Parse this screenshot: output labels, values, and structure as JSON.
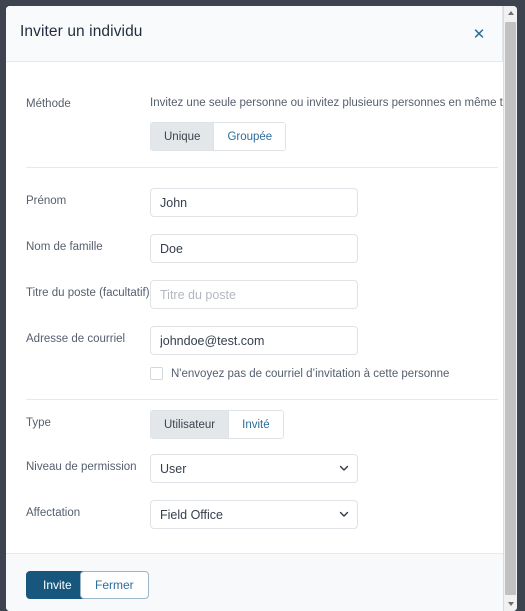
{
  "dialog": {
    "title": "Inviter un individu",
    "close_icon": "close-icon",
    "close_glyph": "✕"
  },
  "method": {
    "label": "Méthode",
    "helper": "Invitez une seule personne ou invitez plusieurs personnes en même temps.",
    "options": [
      {
        "label": "Unique",
        "selected": true
      },
      {
        "label": "Groupée",
        "selected": false
      }
    ]
  },
  "fields": {
    "first_name": {
      "label": "Prénom",
      "value": "John",
      "placeholder": ""
    },
    "last_name": {
      "label": "Nom de famille",
      "value": "Doe",
      "placeholder": ""
    },
    "job_title": {
      "label": "Titre du poste (facultatif)",
      "value": "",
      "placeholder": "Titre du poste"
    },
    "email": {
      "label": "Adresse de courriel",
      "value": "johndoe@test.com",
      "placeholder": ""
    }
  },
  "no_email_checkbox": {
    "label": "N'envoyez pas de courriel d’invitation à cette personne",
    "checked": false
  },
  "type": {
    "label": "Type",
    "options": [
      {
        "label": "Utilisateur",
        "selected": true
      },
      {
        "label": "Invité",
        "selected": false
      }
    ]
  },
  "permission": {
    "label": "Niveau de permission",
    "value": "User",
    "chevron_icon": "chevron-down-icon"
  },
  "assignment": {
    "label": "Affectation",
    "value": "Field Office",
    "chevron_icon": "chevron-down-icon"
  },
  "footer": {
    "primary_label": "Invite",
    "secondary_label": "Fermer"
  },
  "scrollbar": {
    "up_icon": "scroll-up-arrow-icon",
    "down_icon": "scroll-down-arrow-icon"
  },
  "colors": {
    "accent": "#17577e",
    "link": "#2c6e9b",
    "backdrop": "#3d4450",
    "segment_active": "#e4e7ea"
  }
}
